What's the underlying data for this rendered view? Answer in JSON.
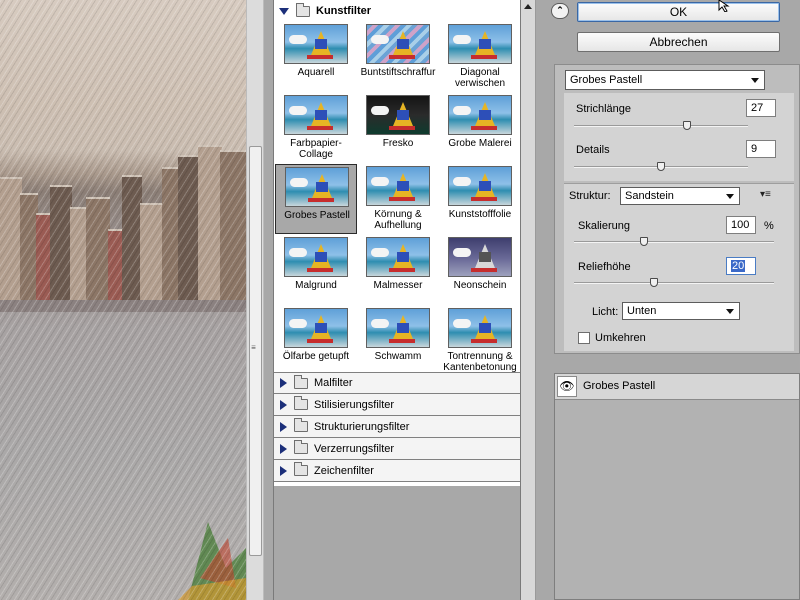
{
  "filter_gallery": {
    "open_category": "Kunstfilter",
    "thumbnails": [
      {
        "label": "Aquarell",
        "style": "normal"
      },
      {
        "label": "Buntstiftschraffur",
        "style": "wave"
      },
      {
        "label": "Diagonal verwischen",
        "style": "normal"
      },
      {
        "label": "Farbpapier-Collage",
        "style": "normal"
      },
      {
        "label": "Fresko",
        "style": "dark"
      },
      {
        "label": "Grobe Malerei",
        "style": "normal"
      },
      {
        "label": "Grobes Pastell",
        "style": "normal",
        "selected": true
      },
      {
        "label": "Körnung & Aufhellung",
        "style": "normal"
      },
      {
        "label": "Kunststofffolie",
        "style": "normal"
      },
      {
        "label": "Malgrund",
        "style": "normal"
      },
      {
        "label": "Malmesser",
        "style": "normal"
      },
      {
        "label": "Neonschein",
        "style": "grey"
      },
      {
        "label": "Ölfarbe getupft",
        "style": "normal"
      },
      {
        "label": "Schwamm",
        "style": "normal"
      },
      {
        "label": "Tontrennung & Kantenbetonung",
        "style": "normal"
      }
    ],
    "closed_categories": [
      "Malfilter",
      "Stilisierungsfilter",
      "Strukturierungsfilter",
      "Verzerrungsfilter",
      "Zeichenfilter"
    ]
  },
  "buttons": {
    "ok": "OK",
    "cancel": "Abbrechen",
    "collapse": "⌃"
  },
  "settings": {
    "filter_select": "Grobes Pastell",
    "strichlaenge": {
      "label": "Strichlänge",
      "value": "27",
      "level": 0.65
    },
    "details": {
      "label": "Details",
      "value": "9",
      "level": 0.5
    },
    "struktur": {
      "label": "Struktur:",
      "value": "Sandstein"
    },
    "skalierung": {
      "label": "Skalierung",
      "value": "100",
      "unit": "%",
      "level": 0.35
    },
    "reliefhoehe": {
      "label": "Reliefhöhe",
      "value": "20",
      "level": 0.4
    },
    "licht": {
      "label": "Licht:",
      "value": "Unten"
    },
    "umkehren": {
      "label": "Umkehren",
      "checked": false
    }
  },
  "effect_layers": [
    {
      "name": "Grobes Pastell",
      "visible": true
    }
  ],
  "colors": {
    "panel_bg": "#a8a8a8",
    "accent": "#3b69c8",
    "selected_thumb": "#a8a8a8"
  },
  "icons": {
    "eye": "eye-icon",
    "folder": "folder-icon",
    "expand": "triangle-right-icon",
    "collapse": "triangle-down-icon",
    "panel_menu": "panel-menu-icon"
  }
}
